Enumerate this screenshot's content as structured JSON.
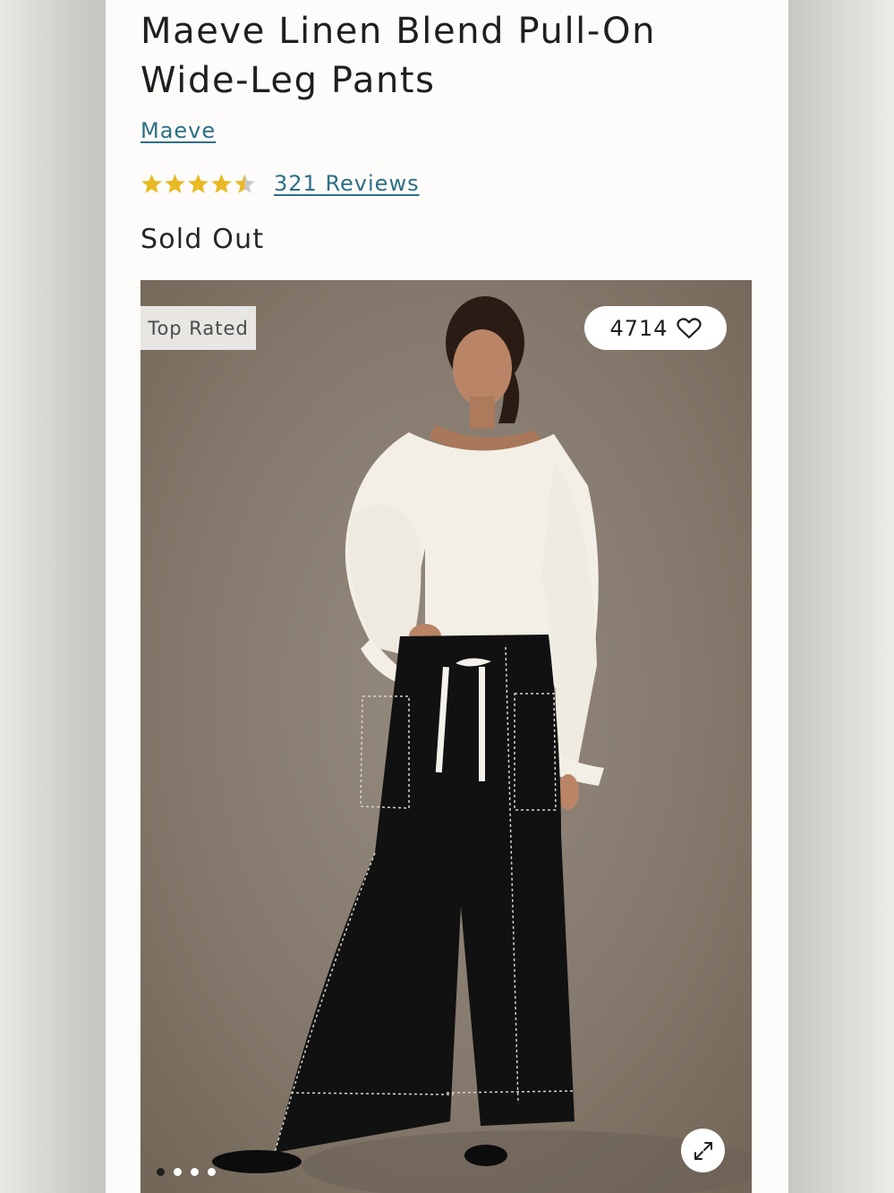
{
  "product": {
    "title": "Maeve Linen Blend Pull-On Wide-Leg Pants",
    "brand": "Maeve",
    "rating_value": 4.5,
    "rating_max": 5,
    "reviews_label": "321 Reviews",
    "status": "Sold Out"
  },
  "gallery": {
    "badge": "Top Rated",
    "favorites_count": "4714",
    "heart_icon": "heart-outline-icon",
    "expand_icon": "expand-arrows-icon",
    "slide_count": 4,
    "active_slide": 0
  },
  "colors": {
    "link": "#2d6f86",
    "star": "#e9b923",
    "star_empty": "#c9c9c9",
    "photo_background": "#85796d"
  }
}
